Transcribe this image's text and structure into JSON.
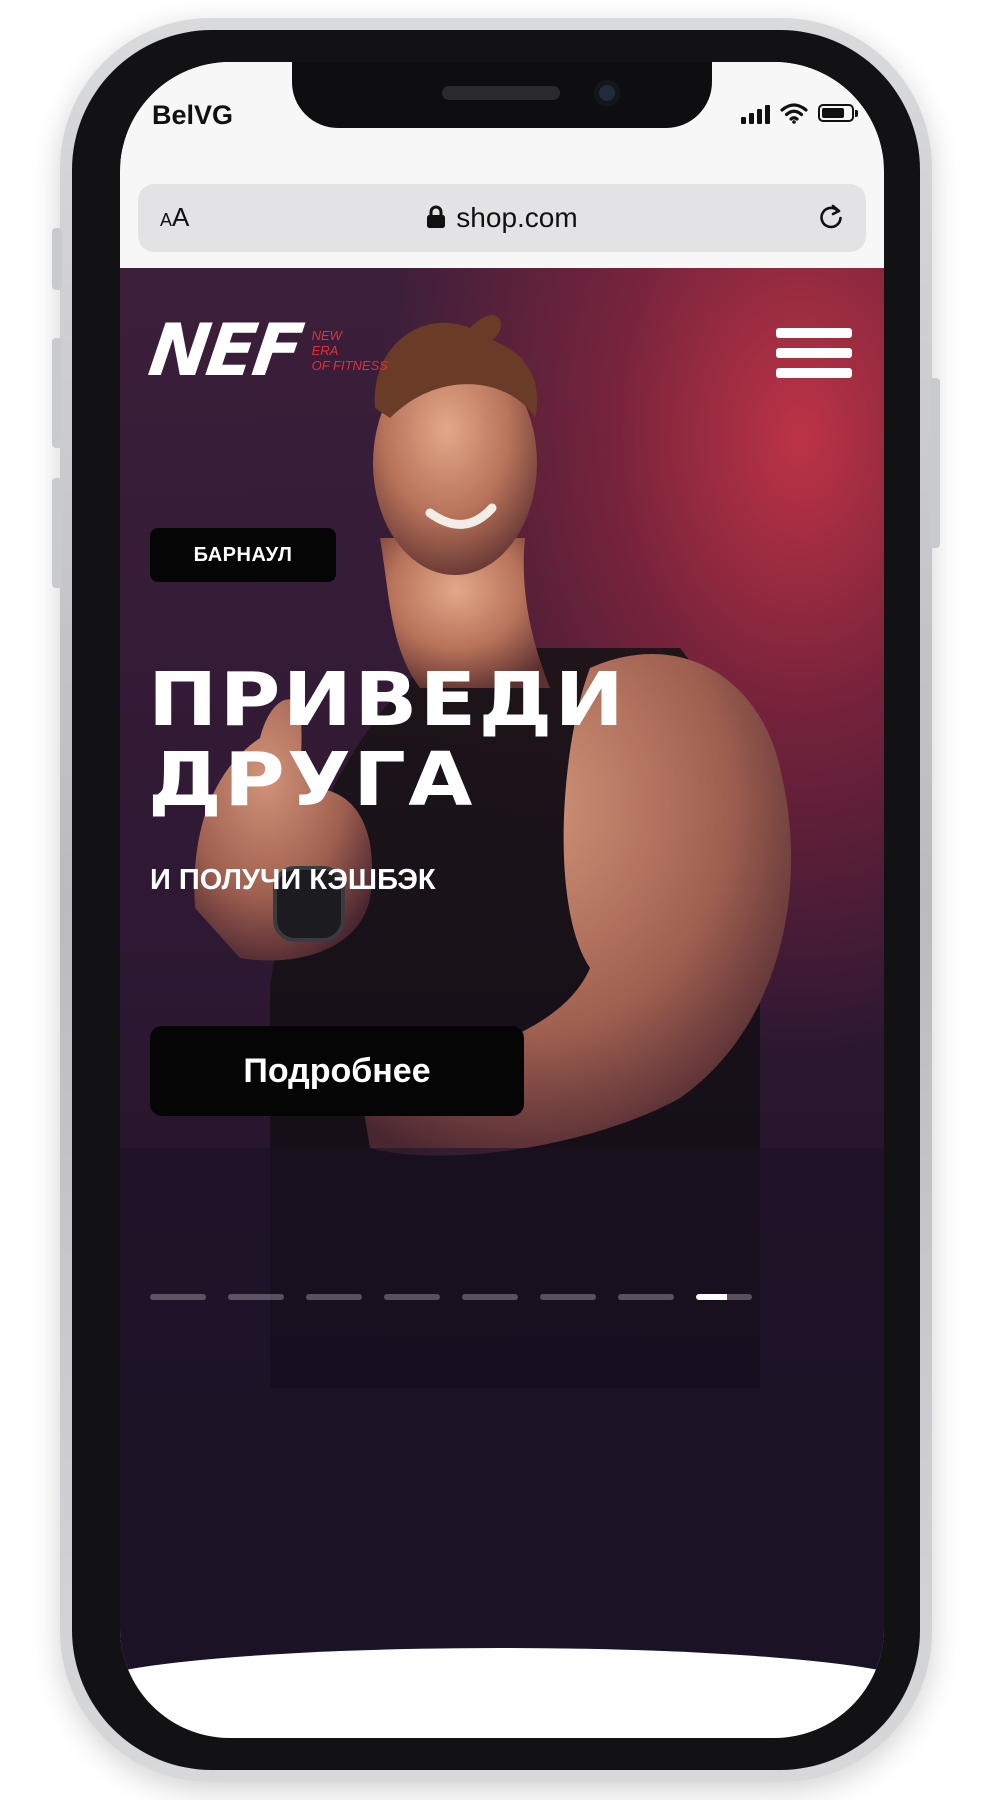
{
  "status_bar": {
    "carrier": "BelVG",
    "signal_bars": 4,
    "battery_level": 0.8
  },
  "browser": {
    "text_size_label_small": "A",
    "text_size_label_large": "A",
    "url": "shop.com",
    "icons": [
      "lock-icon",
      "reload-icon"
    ]
  },
  "site": {
    "logo_text": "NEF",
    "logo_tagline": [
      "NEW",
      "ERA",
      "OF FITNESS"
    ],
    "menu_icon": "hamburger-menu-icon",
    "city": "БАРНАУЛ",
    "headline_line1": "ПРИВЕДИ",
    "headline_line2": "ДРУГА",
    "subheadline": "И ПОЛУЧИ КЭШБЭК",
    "cta_label": "Подробнее",
    "slider": {
      "count": 8,
      "active_index": 7
    }
  },
  "colors": {
    "brand_red": "#e0303b",
    "background_dark": "#1f1428",
    "button_black": "#050505"
  }
}
